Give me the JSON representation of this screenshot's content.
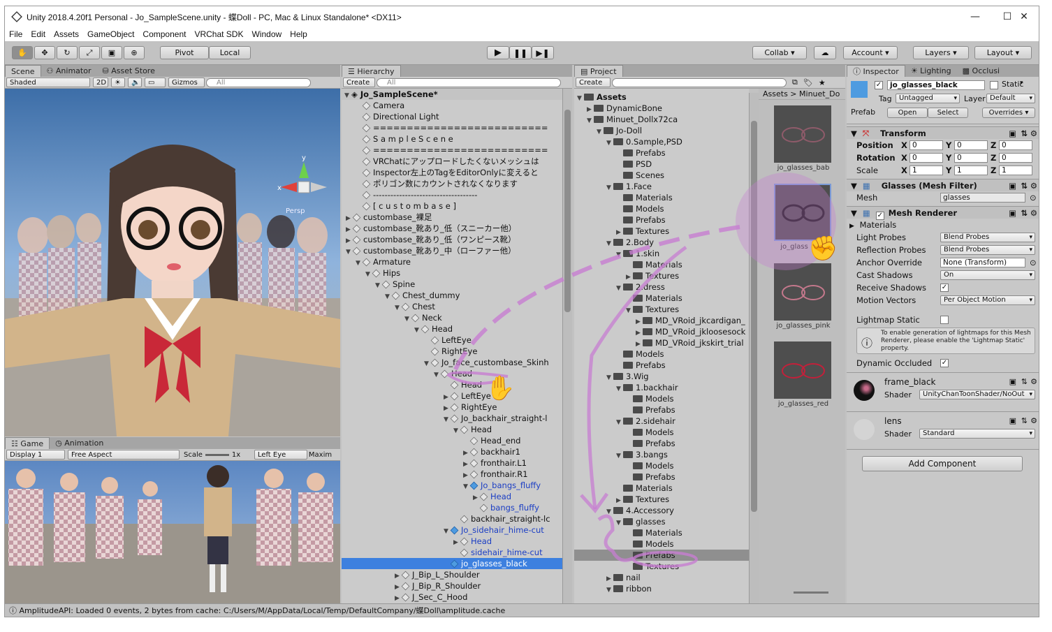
{
  "window": {
    "title": "Unity 2018.4.20f1 Personal - Jo_SampleScene.unity - 蝶Doll - PC, Mac & Linux Standalone* <DX11>"
  },
  "menu": [
    "File",
    "Edit",
    "Assets",
    "GameObject",
    "Component",
    "VRChat SDK",
    "Window",
    "Help"
  ],
  "toolbar": {
    "pivot": "Pivot",
    "local": "Local",
    "collab": "Collab",
    "account": "Account",
    "layers": "Layers",
    "layout": "Layout"
  },
  "scene": {
    "tabs": [
      "Scene",
      "Animator",
      "Asset Store"
    ],
    "shading": "Shaded",
    "mode2d": "2D",
    "gizmos": "Gizmos",
    "search_placeholder": "All",
    "persp": "Persp",
    "axis_x": "x",
    "axis_y": "y"
  },
  "game": {
    "tabs": [
      "Game",
      "Animation"
    ],
    "display": "Display 1",
    "aspect": "Free Aspect",
    "scale_label": "Scale",
    "scale_value": "1x",
    "eye": "Left Eye",
    "maximize": "Maxim"
  },
  "hierarchy": {
    "tab": "Hierarchy",
    "create": "Create",
    "search_placeholder": "All",
    "scene_name": "Jo_SampleScene*",
    "rows": [
      {
        "label": "Camera",
        "indent": 2,
        "arrow": "",
        "type": "go"
      },
      {
        "label": "Directional Light",
        "indent": 2,
        "arrow": "",
        "type": "go"
      },
      {
        "label": "==========================",
        "indent": 2,
        "arrow": "",
        "type": "go"
      },
      {
        "label": "S a m p l e   S c e n e",
        "indent": 2,
        "arrow": "",
        "type": "go"
      },
      {
        "label": "==========================",
        "indent": 2,
        "arrow": "",
        "type": "go"
      },
      {
        "label": "VRChatにアップロードしたくないメッシュは",
        "indent": 2,
        "arrow": "",
        "type": "go"
      },
      {
        "label": "Inspector左上のTagをEditorOnlyに変えると",
        "indent": 2,
        "arrow": "",
        "type": "go"
      },
      {
        "label": "ポリゴン数にカウントされなくなります",
        "indent": 2,
        "arrow": "",
        "type": "go"
      },
      {
        "label": "------------------------------------",
        "indent": 2,
        "arrow": "",
        "type": "go"
      },
      {
        "label": "[ c u s t o m   b a s e ]",
        "indent": 2,
        "arrow": "",
        "type": "go"
      },
      {
        "label": "custombase_裸足",
        "indent": 1,
        "arrow": "▶",
        "type": "go"
      },
      {
        "label": "custombase_靴あり_低（スニーカー他）",
        "indent": 1,
        "arrow": "▶",
        "type": "go"
      },
      {
        "label": "custombase_靴あり_低（ワンピース靴）",
        "indent": 1,
        "arrow": "▶",
        "type": "go"
      },
      {
        "label": "custombase_靴あり_中（ローファー他）",
        "indent": 1,
        "arrow": "▼",
        "type": "go"
      },
      {
        "label": "Armature",
        "indent": 2,
        "arrow": "▼",
        "type": "go"
      },
      {
        "label": "Hips",
        "indent": 3,
        "arrow": "▼",
        "type": "go"
      },
      {
        "label": "Spine",
        "indent": 4,
        "arrow": "▼",
        "type": "go"
      },
      {
        "label": "Chest_dummy",
        "indent": 5,
        "arrow": "▼",
        "type": "go"
      },
      {
        "label": "Chest",
        "indent": 6,
        "arrow": "▼",
        "type": "go"
      },
      {
        "label": "Neck",
        "indent": 7,
        "arrow": "▼",
        "type": "go"
      },
      {
        "label": "Head",
        "indent": 8,
        "arrow": "▼",
        "type": "go"
      },
      {
        "label": "LeftEye",
        "indent": 9,
        "arrow": "",
        "type": "go"
      },
      {
        "label": "RightEye",
        "indent": 9,
        "arrow": "",
        "type": "go"
      },
      {
        "label": "Jo_face_custombase_Skinh",
        "indent": 9,
        "arrow": "▼",
        "type": "go"
      },
      {
        "label": "Head",
        "indent": 10,
        "arrow": "▼",
        "type": "go"
      },
      {
        "label": "Head",
        "indent": 11,
        "arrow": "",
        "type": "go"
      },
      {
        "label": "LeftEye",
        "indent": 11,
        "arrow": "▶",
        "type": "go"
      },
      {
        "label": "RightEye",
        "indent": 11,
        "arrow": "▶",
        "type": "go"
      },
      {
        "label": "Jo_backhair_straight-l",
        "indent": 11,
        "arrow": "▼",
        "type": "go"
      },
      {
        "label": "Head",
        "indent": 12,
        "arrow": "▼",
        "type": "go"
      },
      {
        "label": "Head_end",
        "indent": 13,
        "arrow": "",
        "type": "go"
      },
      {
        "label": "backhair1",
        "indent": 13,
        "arrow": "▶",
        "type": "go"
      },
      {
        "label": "fronthair.L1",
        "indent": 13,
        "arrow": "▶",
        "type": "go"
      },
      {
        "label": "fronthair.R1",
        "indent": 13,
        "arrow": "▶",
        "type": "go"
      },
      {
        "label": "Jo_bangs_fluffy",
        "indent": 13,
        "arrow": "▼",
        "type": "prefab"
      },
      {
        "label": "Head",
        "indent": 14,
        "arrow": "▶",
        "type": "blue"
      },
      {
        "label": "bangs_fluffy",
        "indent": 14,
        "arrow": "",
        "type": "blue"
      },
      {
        "label": "backhair_straight-lc",
        "indent": 12,
        "arrow": "",
        "type": "go"
      },
      {
        "label": "Jo_sidehair_hime-cut",
        "indent": 11,
        "arrow": "▼",
        "type": "prefab"
      },
      {
        "label": "Head",
        "indent": 12,
        "arrow": "▶",
        "type": "blue"
      },
      {
        "label": "sidehair_hime-cut",
        "indent": 12,
        "arrow": "",
        "type": "blue"
      },
      {
        "label": "jo_glasses_black",
        "indent": 11,
        "arrow": "",
        "type": "selected"
      },
      {
        "label": "J_Bip_L_Shoulder",
        "indent": 6,
        "arrow": "▶",
        "type": "go"
      },
      {
        "label": "J_Bip_R_Shoulder",
        "indent": 6,
        "arrow": "▶",
        "type": "go"
      },
      {
        "label": "J_Sec_C_Hood",
        "indent": 6,
        "arrow": "▶",
        "type": "go"
      }
    ]
  },
  "project": {
    "tab": "Project",
    "create": "Create",
    "root": "Assets",
    "breadcrumb": [
      "Assets",
      "Minuet_Do"
    ],
    "tree": [
      {
        "label": "DynamicBone",
        "indent": 1,
        "arrow": "▶"
      },
      {
        "label": "Minuet_Dollx72ca",
        "indent": 1,
        "arrow": "▼"
      },
      {
        "label": "Jo-Doll",
        "indent": 2,
        "arrow": "▼"
      },
      {
        "label": "0.Sample,PSD",
        "indent": 3,
        "arrow": "▼"
      },
      {
        "label": "Prefabs",
        "indent": 4,
        "arrow": ""
      },
      {
        "label": "PSD",
        "indent": 4,
        "arrow": ""
      },
      {
        "label": "Scenes",
        "indent": 4,
        "arrow": ""
      },
      {
        "label": "1.Face",
        "indent": 3,
        "arrow": "▼"
      },
      {
        "label": "Materials",
        "indent": 4,
        "arrow": ""
      },
      {
        "label": "Models",
        "indent": 4,
        "arrow": ""
      },
      {
        "label": "Prefabs",
        "indent": 4,
        "arrow": ""
      },
      {
        "label": "Textures",
        "indent": 4,
        "arrow": "▶"
      },
      {
        "label": "2.Body",
        "indent": 3,
        "arrow": "▼"
      },
      {
        "label": "1.skin",
        "indent": 4,
        "arrow": "▼"
      },
      {
        "label": "Materials",
        "indent": 5,
        "arrow": ""
      },
      {
        "label": "Textures",
        "indent": 5,
        "arrow": "▶"
      },
      {
        "label": "2.dress",
        "indent": 4,
        "arrow": "▼"
      },
      {
        "label": "Materials",
        "indent": 5,
        "arrow": ""
      },
      {
        "label": "Textures",
        "indent": 5,
        "arrow": "▼"
      },
      {
        "label": "MD_VRoid_jkcardigan_",
        "indent": 6,
        "arrow": "▶"
      },
      {
        "label": "MD_VRoid_jkloosesock",
        "indent": 6,
        "arrow": "▶"
      },
      {
        "label": "MD_VRoid_jkskirt_trial",
        "indent": 6,
        "arrow": "▶"
      },
      {
        "label": "Models",
        "indent": 4,
        "arrow": ""
      },
      {
        "label": "Prefabs",
        "indent": 4,
        "arrow": ""
      },
      {
        "label": "3.Wig",
        "indent": 3,
        "arrow": "▼"
      },
      {
        "label": "1.backhair",
        "indent": 4,
        "arrow": "▼"
      },
      {
        "label": "Models",
        "indent": 5,
        "arrow": ""
      },
      {
        "label": "Prefabs",
        "indent": 5,
        "arrow": ""
      },
      {
        "label": "2.sidehair",
        "indent": 4,
        "arrow": "▼"
      },
      {
        "label": "Models",
        "indent": 5,
        "arrow": ""
      },
      {
        "label": "Prefabs",
        "indent": 5,
        "arrow": ""
      },
      {
        "label": "3.bangs",
        "indent": 4,
        "arrow": "▼"
      },
      {
        "label": "Models",
        "indent": 5,
        "arrow": ""
      },
      {
        "label": "Prefabs",
        "indent": 5,
        "arrow": ""
      },
      {
        "label": "Materials",
        "indent": 4,
        "arrow": ""
      },
      {
        "label": "Textures",
        "indent": 4,
        "arrow": "▶"
      },
      {
        "label": "4.Accessory",
        "indent": 3,
        "arrow": "▼"
      },
      {
        "label": "glasses",
        "indent": 4,
        "arrow": "▼"
      },
      {
        "label": "Materials",
        "indent": 5,
        "arrow": ""
      },
      {
        "label": "Models",
        "indent": 5,
        "arrow": ""
      },
      {
        "label": "Prefabs",
        "indent": 5,
        "arrow": "",
        "selected": true
      },
      {
        "label": "Textures",
        "indent": 5,
        "arrow": ""
      },
      {
        "label": "nail",
        "indent": 3,
        "arrow": "▶"
      },
      {
        "label": "ribbon",
        "indent": 3,
        "arrow": "▼"
      }
    ],
    "assets": [
      "jo_glasses_bab",
      "jo_glass",
      "jo_glasses_pink",
      "jo_glasses_red"
    ]
  },
  "inspector": {
    "tabs": [
      "Inspector",
      "Lighting",
      "Occlusi"
    ],
    "object_name": "jo_glasses_black",
    "static": "Static",
    "tag_label": "Tag",
    "tag": "Untagged",
    "layer_label": "Layer",
    "layer": "Default",
    "prefab_label": "Prefab",
    "open": "Open",
    "select": "Select",
    "overrides": "Overrides",
    "transform": {
      "title": "Transform",
      "position": "Position",
      "rotation": "Rotation",
      "scale": "Scale",
      "pos": [
        "0",
        "0",
        "0"
      ],
      "rot": [
        "0",
        "0",
        "0"
      ],
      "scl": [
        "1",
        "1",
        "1"
      ],
      "x": "X",
      "y": "Y",
      "z": "Z"
    },
    "mesh_filter": {
      "title": "Glasses (Mesh Filter)",
      "mesh_label": "Mesh",
      "mesh": "glasses"
    },
    "mesh_renderer": {
      "title": "Mesh Renderer",
      "materials": "Materials",
      "light_probes_label": "Light Probes",
      "light_probes": "Blend Probes",
      "reflection_label": "Reflection Probes",
      "reflection": "Blend Probes",
      "anchor_label": "Anchor Override",
      "anchor": "None (Transform)",
      "cast_label": "Cast Shadows",
      "cast": "On",
      "receive_label": "Receive Shadows",
      "motion_label": "Motion Vectors",
      "motion": "Per Object Motion",
      "lightmap_label": "Lightmap Static",
      "info": "To enable generation of lightmaps for this Mesh Renderer, please enable the 'Lightmap Static' property.",
      "dynamic_label": "Dynamic Occluded"
    },
    "materials": [
      {
        "name": "frame_black",
        "shader_label": "Shader",
        "shader": "UnityChanToonShader/NoOut"
      },
      {
        "name": "lens",
        "shader_label": "Shader",
        "shader": "Standard"
      }
    ],
    "add_component": "Add Component"
  },
  "status": "AmplitudeAPI: Loaded 0 events, 2 bytes from cache: C:/Users/M/AppData/Local/Temp/DefaultCompany/蝶Doll\\amplitude.cache",
  "colors": {
    "selection": "#3d80df",
    "annotation": "#c77dd1",
    "sky": "#8fb3dc"
  }
}
